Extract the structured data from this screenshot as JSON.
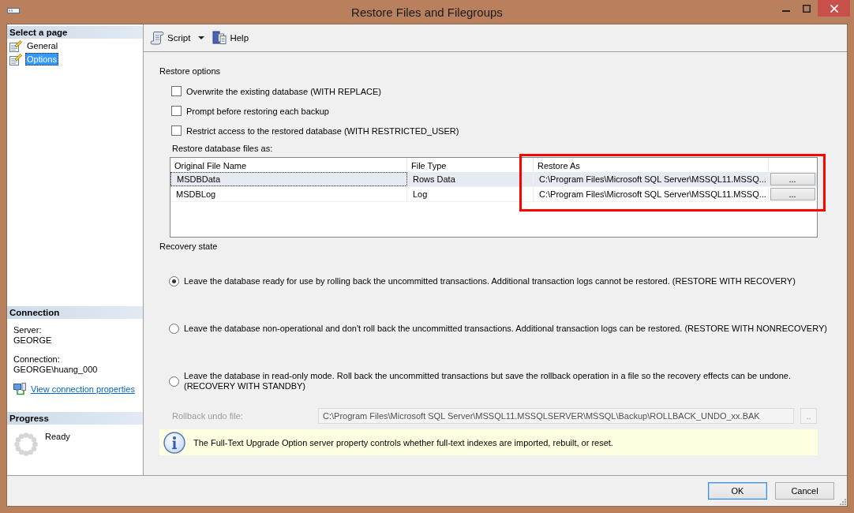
{
  "window": {
    "title": "Restore Files and Filegroups"
  },
  "sidebar": {
    "pages_header": "Select a page",
    "pages": [
      {
        "label": "General",
        "selected": false
      },
      {
        "label": "Options",
        "selected": true
      }
    ],
    "connection_header": "Connection",
    "connection": [
      {
        "label": "Server:",
        "value": "GEORGE"
      },
      {
        "label": "Connection:",
        "value": "GEORGE\\huang_000"
      }
    ],
    "connection_link": "View connection properties",
    "progress_header": "Progress",
    "progress_status": "Ready"
  },
  "toolbar": {
    "items": [
      {
        "kind": "script",
        "label": "Script",
        "dropdown": true
      },
      {
        "kind": "help",
        "label": "Help",
        "dropdown": false
      }
    ]
  },
  "restore_options": {
    "title": "Restore options",
    "checkboxes": [
      {
        "label": "Overwrite the existing database (WITH REPLACE)",
        "checked": false
      },
      {
        "label": "Prompt before restoring each backup",
        "checked": false
      },
      {
        "label": "Restrict access to the restored database (WITH RESTRICTED_USER)",
        "checked": false
      }
    ],
    "files_label": "Restore database files as:",
    "files_table": {
      "columns": [
        "Original File Name",
        "File Type",
        "Restore As"
      ],
      "rows": [
        {
          "cells": [
            "MSDBData",
            "Rows Data",
            "C:\\Program Files\\Microsoft SQL Server\\MSSQL11.MSSQ..."
          ],
          "button": "...",
          "selected": true
        },
        {
          "cells": [
            "MSDBLog",
            "Log",
            "C:\\Program Files\\Microsoft SQL Server\\MSSQL11.MSSQ..."
          ],
          "button": "...",
          "selected": false
        }
      ]
    }
  },
  "recovery_state": {
    "title": "Recovery state",
    "options": [
      {
        "label": "Leave the database ready for use by rolling back the uncommitted transactions. Additional transaction logs cannot be restored. (RESTORE WITH RECOVERY)",
        "selected": true
      },
      {
        "label": "Leave the database non-operational and don't roll back the uncommitted transactions. Additional transaction logs can be restored. (RESTORE WITH NONRECOVERY)",
        "selected": false
      },
      {
        "label": "Leave the database in read-only mode. Roll back the uncommitted transactions but save the rollback operation in a file so the recovery effects can be undone. (RECOVERY WITH STANDBY)",
        "selected": false
      }
    ],
    "undo_file": {
      "label": "Rollback undo file:",
      "value": "C:\\Program Files\\Microsoft SQL Server\\MSSQL11.MSSQLSERVER\\MSSQL\\Backup\\ROLLBACK_UNDO_xx.BAK",
      "button": "..",
      "disabled": true
    }
  },
  "info": {
    "text": "The Full-Text Upgrade Option server property controls whether full-text indexes are imported, rebuilt, or reset."
  },
  "buttons": [
    {
      "label": "OK",
      "focused": true
    },
    {
      "label": "Cancel",
      "focused": false
    }
  ]
}
